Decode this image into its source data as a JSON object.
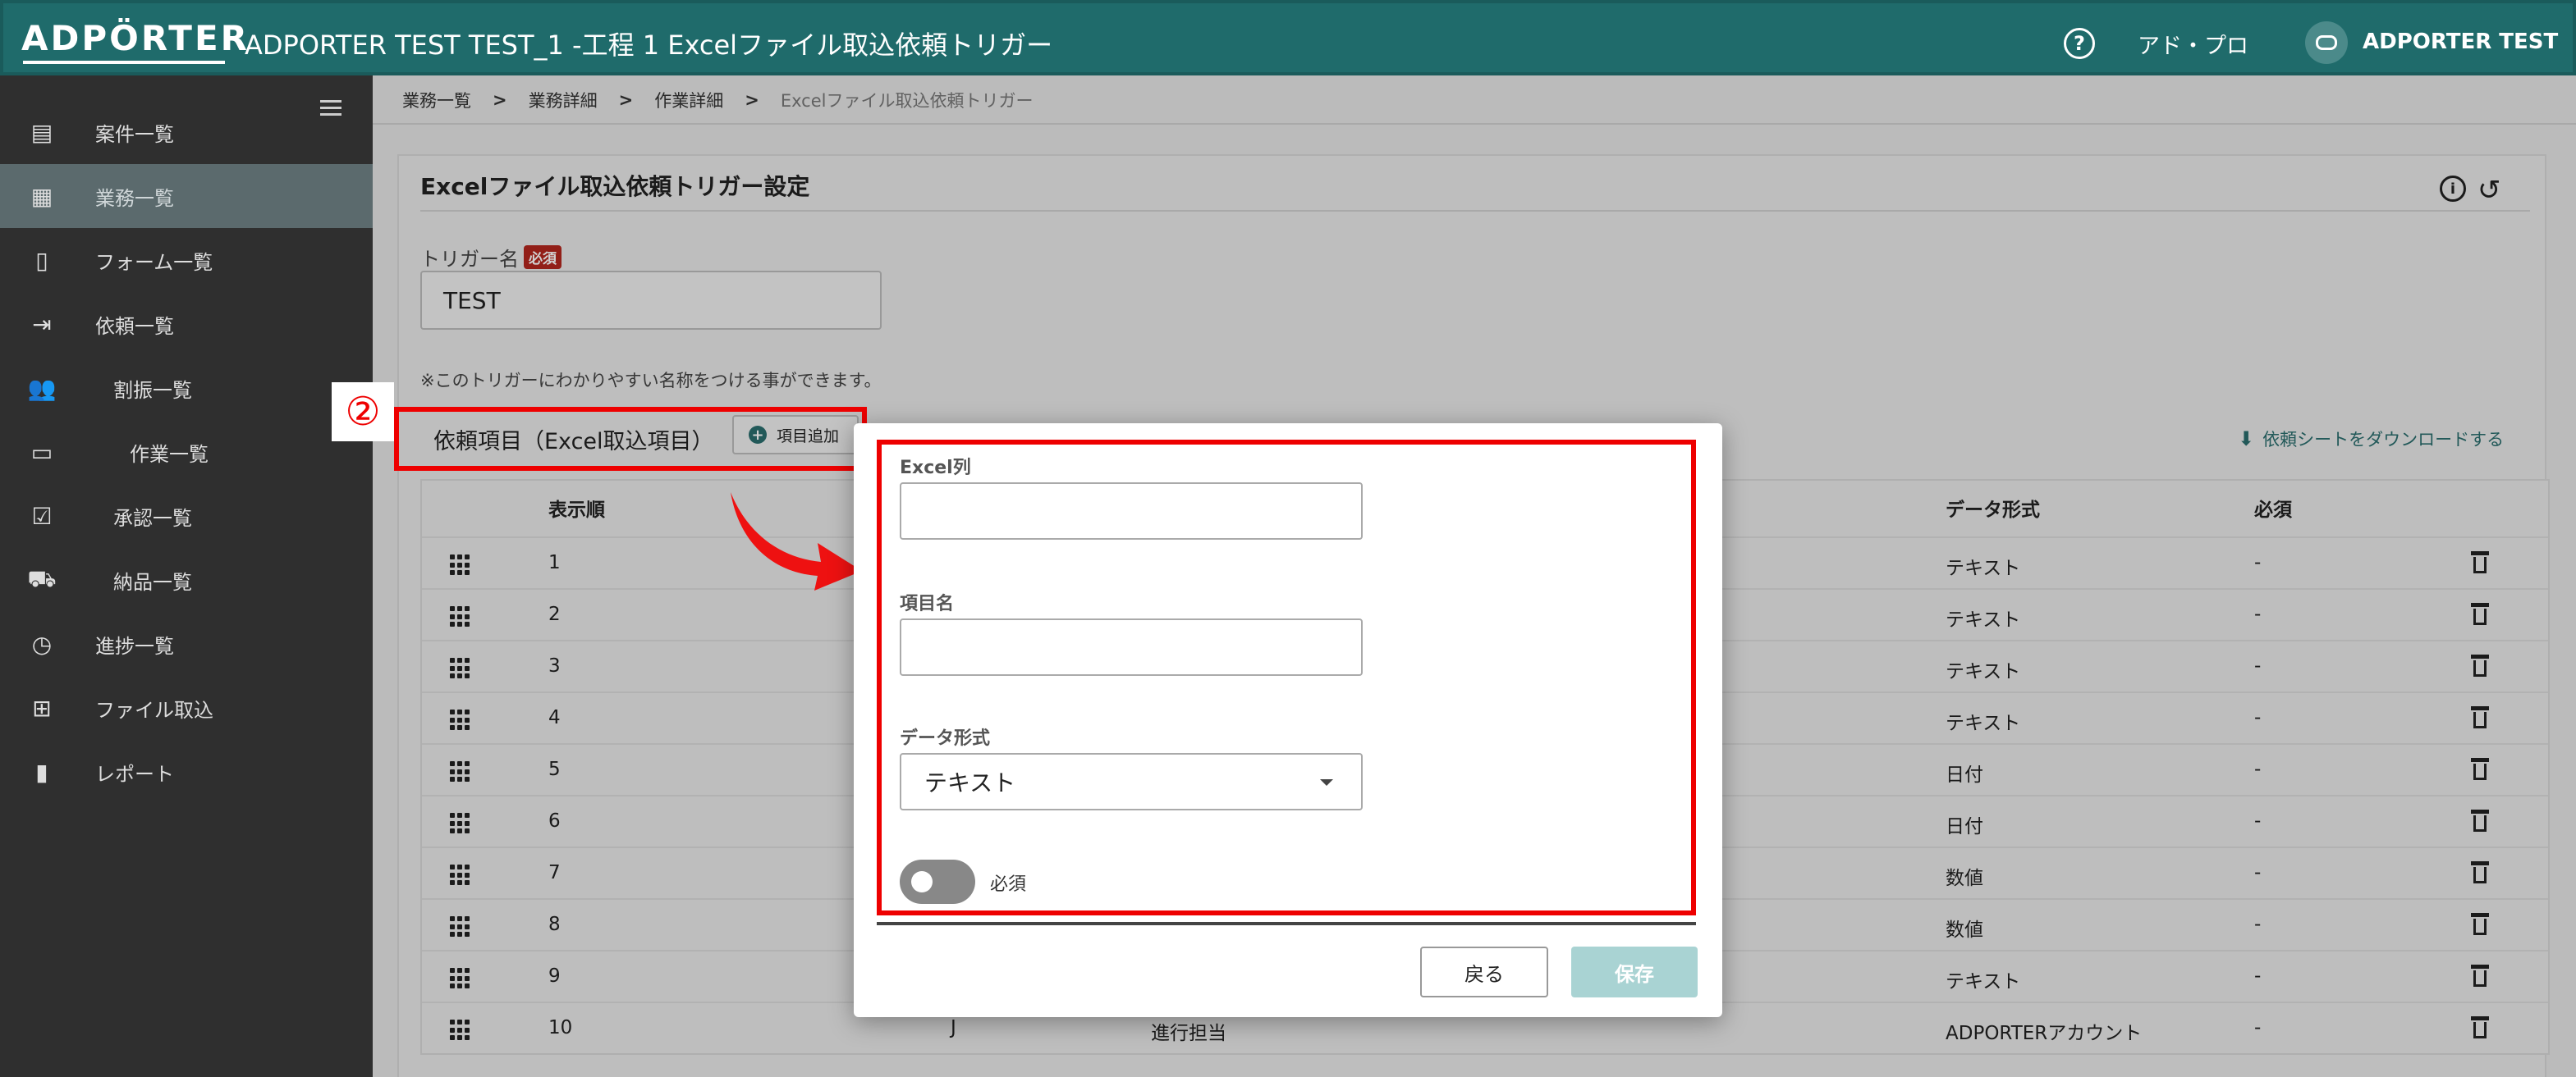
{
  "header": {
    "logo": "ADPÖRTER",
    "title": "ADPORTER TEST TEST_1 -工程 1 Excelファイル取込依頼トリガー",
    "help_icon": "help-circle-icon",
    "help_glyph": "?",
    "org": "アド・プロ",
    "user": "ADPORTER TEST"
  },
  "sidebar": {
    "items": [
      {
        "label": "案件一覧",
        "icon": "document-icon",
        "glyph": "▤"
      },
      {
        "label": "業務一覧",
        "icon": "building-icon",
        "glyph": "▦"
      },
      {
        "label": "フォーム一覧",
        "icon": "form-icon",
        "glyph": "▯"
      },
      {
        "label": "依頼一覧",
        "icon": "inbox-icon",
        "glyph": "⇥"
      },
      {
        "label": "割振一覧",
        "icon": "people-icon",
        "glyph": "👥"
      },
      {
        "label": "作業一覧",
        "icon": "monitor-icon",
        "glyph": "▭"
      },
      {
        "label": "承認一覧",
        "icon": "approval-icon",
        "glyph": "☑"
      },
      {
        "label": "納品一覧",
        "icon": "truck-icon",
        "glyph": "⛟"
      },
      {
        "label": "進捗一覧",
        "icon": "clock-icon",
        "glyph": "◷"
      },
      {
        "label": "ファイル取込",
        "icon": "table-add-icon",
        "glyph": "⊞"
      },
      {
        "label": "レポート",
        "icon": "bar-chart-icon",
        "glyph": "▮"
      }
    ]
  },
  "breadcrumb": {
    "items": [
      "業務一覧",
      "業務詳細",
      "作業詳細"
    ],
    "current": "Excelファイル取込依頼トリガー",
    "sep": ">"
  },
  "card": {
    "title": "Excelファイル取込依頼トリガー設定",
    "info_glyph": "i",
    "history_glyph": "↺",
    "trigger_label": "トリガー名",
    "required_badge": "必須",
    "trigger_value": "TEST",
    "hint": "※このトリガーにわかりやすい名称をつける事ができます。"
  },
  "section": {
    "badge": "②",
    "title": "依頼項目（Excel取込項目）",
    "add_label": "項目追加",
    "add_glyph": "+",
    "download_glyph": "⬇",
    "download_label": "依頼シートをダウンロードする"
  },
  "table": {
    "headers": {
      "order": "表示順",
      "format": "データ形式",
      "required": "必須"
    },
    "rows": [
      {
        "order": "1",
        "col": "",
        "name": "",
        "format": "テキスト",
        "required": "-"
      },
      {
        "order": "2",
        "col": "",
        "name": "",
        "format": "テキスト",
        "required": "-"
      },
      {
        "order": "3",
        "col": "",
        "name": "",
        "format": "テキスト",
        "required": "-"
      },
      {
        "order": "4",
        "col": "",
        "name": "",
        "format": "テキスト",
        "required": "-"
      },
      {
        "order": "5",
        "col": "",
        "name": "",
        "format": "日付",
        "required": "-"
      },
      {
        "order": "6",
        "col": "",
        "name": "",
        "format": "日付",
        "required": "-"
      },
      {
        "order": "7",
        "col": "",
        "name": "",
        "format": "数値",
        "required": "-"
      },
      {
        "order": "8",
        "col": "",
        "name": "",
        "format": "数値",
        "required": "-"
      },
      {
        "order": "9",
        "col": "",
        "name": "",
        "format": "テキスト",
        "required": "-"
      },
      {
        "order": "10",
        "col": "J",
        "name": "進行担当",
        "format": "ADPORTERアカウント",
        "required": "-"
      }
    ]
  },
  "modal": {
    "excel_col_label": "Excel列",
    "excel_col_value": "",
    "item_name_label": "項目名",
    "item_name_value": "",
    "format_label": "データ形式",
    "format_value": "テキスト",
    "required_label": "必須",
    "required_on": false,
    "back_label": "戻る",
    "save_label": "保存"
  },
  "colors": {
    "header": "#1f6b6b",
    "sidebar": "#2f2f2f",
    "highlight": "#ee0000",
    "save_disabled": "#a9d3d3"
  }
}
